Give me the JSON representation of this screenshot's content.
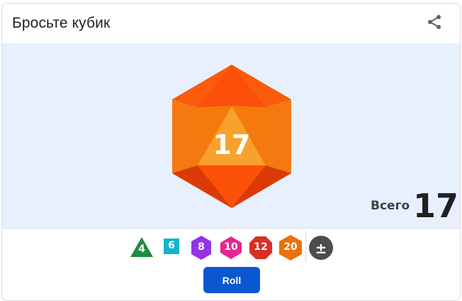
{
  "header": {
    "title": "Бросьте кубик",
    "share_icon": "share-icon"
  },
  "result": {
    "die_type": "d20",
    "die_value": "17",
    "total_label": "Всего",
    "total_value": "17"
  },
  "dice": [
    {
      "label": "4",
      "sides": "d4",
      "color": "#1e8e3e",
      "shape": "triangle"
    },
    {
      "label": "6",
      "sides": "d6",
      "color": "#12b5cb",
      "shape": "square"
    },
    {
      "label": "8",
      "sides": "d8",
      "color": "#9334e6",
      "shape": "hexagon"
    },
    {
      "label": "10",
      "sides": "d10",
      "color": "#e52592",
      "shape": "diamond-hex"
    },
    {
      "label": "12",
      "sides": "d12",
      "color": "#d93025",
      "shape": "octagon"
    },
    {
      "label": "20",
      "sides": "d20",
      "color": "#e8710a",
      "shape": "hexagon"
    },
    {
      "label": "±",
      "sides": "modifier",
      "color": "#5f6368",
      "shape": "circle"
    }
  ],
  "actions": {
    "roll_label": "Roll"
  },
  "colors": {
    "die_main": "#e8710a",
    "stage_bg": "#e8f0fe",
    "roll_button": "#0b57d0"
  }
}
